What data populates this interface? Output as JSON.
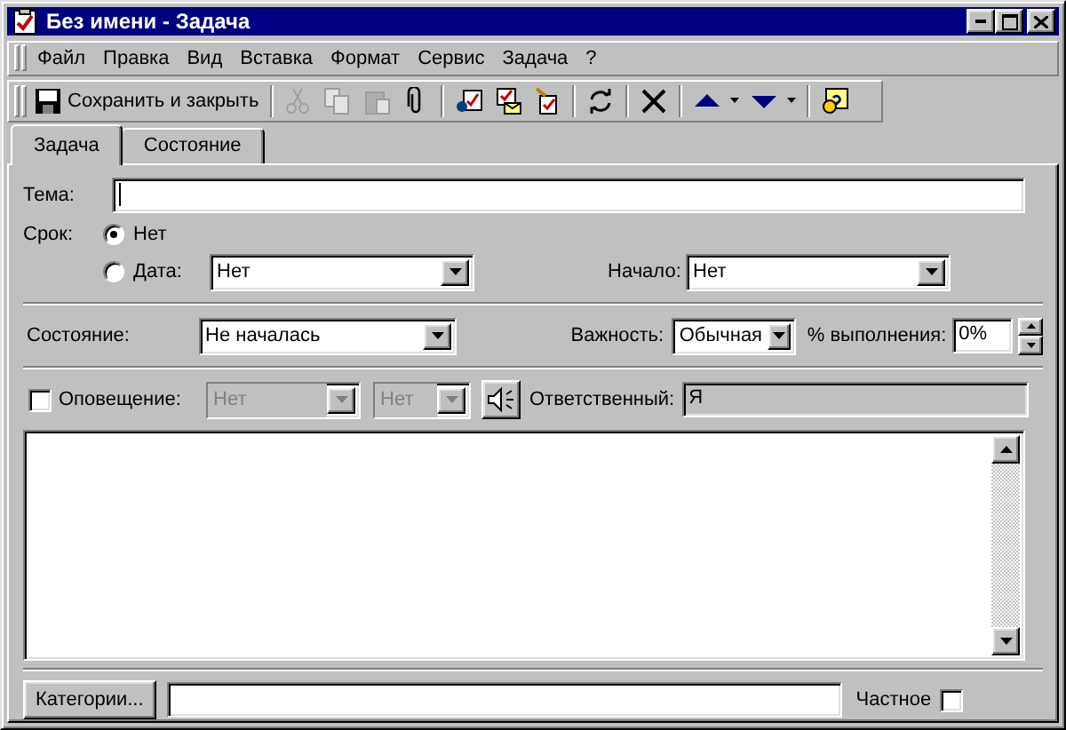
{
  "window": {
    "title": "Без имени - Задача"
  },
  "menu": [
    "Файл",
    "Правка",
    "Вид",
    "Вставка",
    "Формат",
    "Сервис",
    "Задача",
    "?"
  ],
  "toolbar": [
    {
      "kind": "save",
      "label": "Сохранить и закрыть",
      "disabled": false
    },
    {
      "kind": "separator"
    },
    {
      "kind": "cut",
      "disabled": true
    },
    {
      "kind": "copy",
      "disabled": true
    },
    {
      "kind": "paste",
      "disabled": true
    },
    {
      "kind": "attach",
      "disabled": false
    },
    {
      "kind": "separator"
    },
    {
      "kind": "assign",
      "disabled": false
    },
    {
      "kind": "report",
      "disabled": false
    },
    {
      "kind": "complete",
      "disabled": false
    },
    {
      "kind": "separator"
    },
    {
      "kind": "recur",
      "disabled": false
    },
    {
      "kind": "separator"
    },
    {
      "kind": "delete",
      "disabled": false
    },
    {
      "kind": "separator"
    },
    {
      "kind": "up",
      "disabled": false
    },
    {
      "kind": "down",
      "disabled": false
    },
    {
      "kind": "separator"
    },
    {
      "kind": "help",
      "disabled": false
    }
  ],
  "tabs": [
    {
      "label": "Задача",
      "selected": true
    },
    {
      "label": "Состояние",
      "selected": false
    }
  ],
  "form": {
    "subject": {
      "label": "Тема:"
    },
    "due": {
      "label": "Срок:",
      "options": [
        {
          "label": "Нет",
          "selected": true
        },
        {
          "label": "Дата:",
          "selected": false
        }
      ],
      "date": "Нет"
    },
    "start": {
      "label": "Начало:",
      "value": "Нет"
    },
    "status": {
      "label": "Состояние:",
      "value": "Не началась"
    },
    "priority": {
      "label": "Важность:",
      "value": "Обычная"
    },
    "complete": {
      "label": "% выполнения:",
      "value": "0%"
    },
    "reminder": {
      "label": "Оповещение:",
      "checked": false,
      "date": "Нет",
      "time": "Нет",
      "disabled": true
    },
    "owner": {
      "label": "Ответственный:",
      "value": "Я"
    },
    "categories_button": "Категории...",
    "private": {
      "label": "Частное",
      "checked": false
    }
  }
}
